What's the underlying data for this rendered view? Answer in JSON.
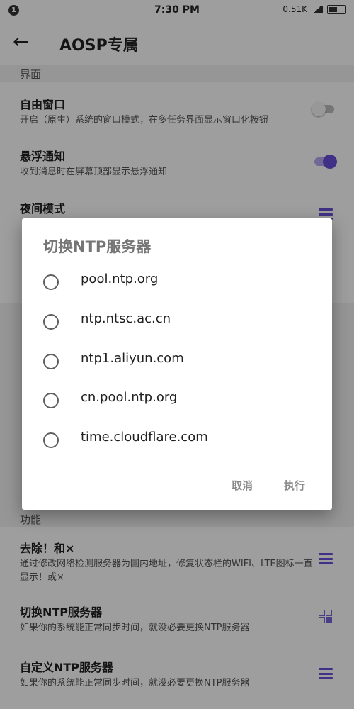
{
  "status_bar": {
    "notification_badge": "1",
    "time": "7:30 PM",
    "net_speed": "0.51K"
  },
  "app_bar": {
    "back_icon": "arrow-left-icon",
    "title": "AOSP专属"
  },
  "sections": {
    "interface_label": "界面",
    "interface_items": [
      {
        "title": "自由窗口",
        "desc": "开启（原生）系统的窗口模式，在多任务界面显示窗口化按钮",
        "control": "switch-off"
      },
      {
        "title": "悬浮通知",
        "desc": "收到消息时在屏幕顶部显示悬浮通知",
        "control": "switch-on"
      },
      {
        "title": "夜间模式",
        "desc": "",
        "control": "menu-icon"
      }
    ],
    "function_label": "功能",
    "function_items": [
      {
        "title": "去除！和×",
        "desc": "通过修改网络检测服务器为国内地址，修复状态栏的WIFI、LTE图标一直显示！或×",
        "control": "menu-icon"
      },
      {
        "title": "切换NTP服务器",
        "desc": "如果你的系统能正常同步时间，就没必要更换NTP服务器",
        "control": "grid-icon"
      },
      {
        "title": "自定义NTP服务器",
        "desc": "如果你的系统能正常同步时间，就没必要更换NTP服务器",
        "control": "menu-icon"
      }
    ]
  },
  "dialog": {
    "title": "切换NTP服务器",
    "options": [
      "pool.ntp.org",
      "ntp.ntsc.ac.cn",
      "ntp1.aliyun.com",
      "cn.pool.ntp.org",
      "time.cloudflare.com"
    ],
    "cancel_label": "取消",
    "execute_label": "执行"
  },
  "colors": {
    "accent": "#6a4fd8",
    "scrim": "rgba(0,0,0,0.38)"
  }
}
